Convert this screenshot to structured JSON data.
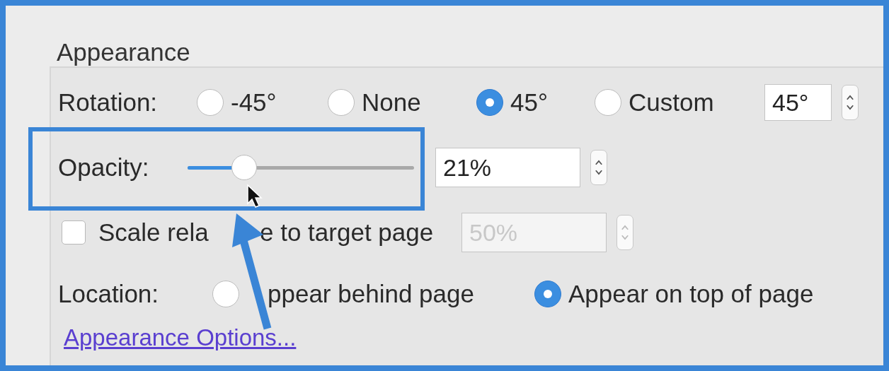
{
  "section": {
    "title": "Appearance"
  },
  "rotation": {
    "label": "Rotation:",
    "options": [
      {
        "label": "-45°",
        "selected": false
      },
      {
        "label": "None",
        "selected": false
      },
      {
        "label": "45°",
        "selected": true
      },
      {
        "label": "Custom",
        "selected": false
      }
    ],
    "custom_value": "45°"
  },
  "opacity": {
    "label": "Opacity:",
    "level": 0.25,
    "value": "21%"
  },
  "scale": {
    "label_parts": [
      "Scale rela",
      "e to target page"
    ],
    "checked": false,
    "disabled": true,
    "value": "50%"
  },
  "location": {
    "label": "Location:",
    "options": [
      {
        "label": "ppear behind page",
        "selected": false
      },
      {
        "label": "Appear on top of page",
        "selected": true
      }
    ]
  },
  "link": {
    "label": "Appearance Options..."
  }
}
